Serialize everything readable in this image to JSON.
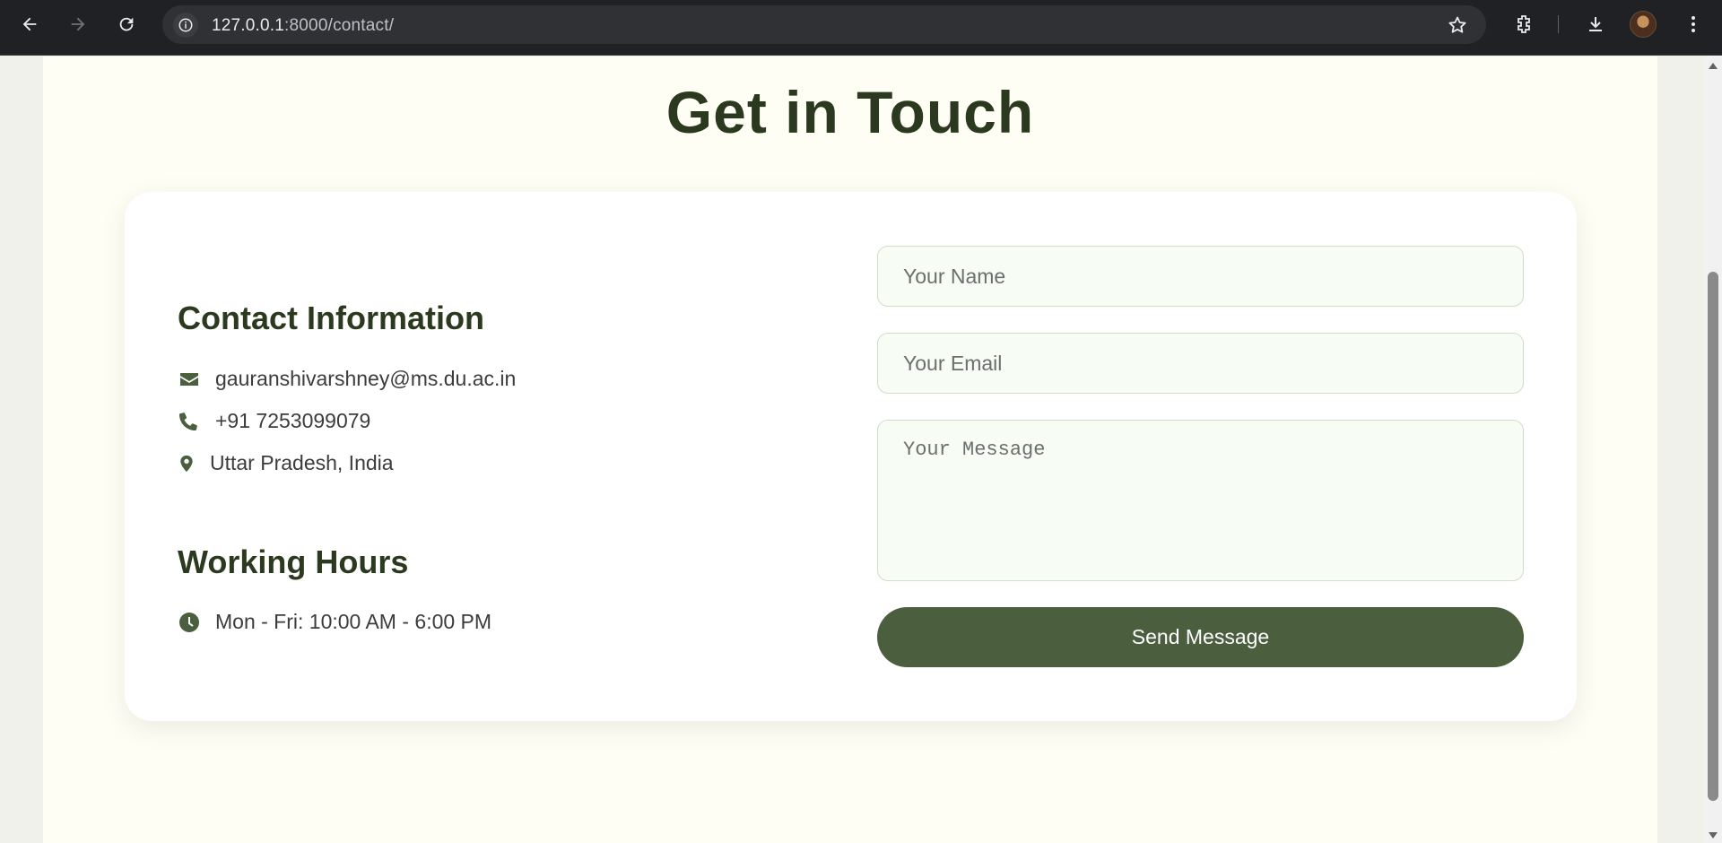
{
  "browser": {
    "url_host": "127.0.0.1",
    "url_rest": ":8000/contact/"
  },
  "page": {
    "title": "Get in Touch"
  },
  "contact": {
    "heading": "Contact Information",
    "email": "gauranshivarshney@ms.du.ac.in",
    "phone": "+91 7253099079",
    "location": "Uttar Pradesh, India"
  },
  "hours": {
    "heading": "Working Hours",
    "text": "Mon - Fri: 10:00 AM - 6:00 PM"
  },
  "form": {
    "name_placeholder": "Your Name",
    "email_placeholder": "Your Email",
    "message_placeholder": "Your Message",
    "submit_label": "Send Message"
  },
  "colors": {
    "accent": "#4b5e3e",
    "heading": "#2b3a1f",
    "panel_bg": "#fefef5"
  }
}
